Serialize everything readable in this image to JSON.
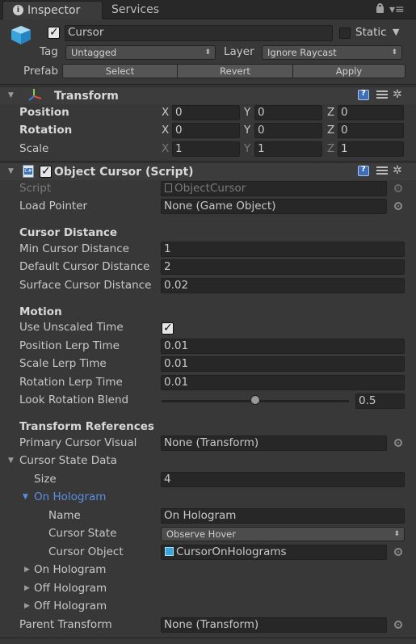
{
  "tabs": {
    "inspector": "Inspector",
    "services": "Services"
  },
  "object": {
    "name": "Cursor",
    "static_label": "Static",
    "tag_label": "Tag",
    "tag_value": "Untagged",
    "layer_label": "Layer",
    "layer_value": "Ignore Raycast",
    "prefab_label": "Prefab",
    "prefab_buttons": {
      "select": "Select",
      "revert": "Revert",
      "apply": "Apply"
    }
  },
  "transform": {
    "title": "Transform",
    "rows": [
      {
        "label": "Position",
        "x": "0",
        "y": "0",
        "z": "0"
      },
      {
        "label": "Rotation",
        "x": "0",
        "y": "0",
        "z": "0"
      },
      {
        "label": "Scale",
        "x": "1",
        "y": "1",
        "z": "1"
      }
    ],
    "axis": {
      "x": "X",
      "y": "Y",
      "z": "Z"
    }
  },
  "script": {
    "title": "Object Cursor (Script)",
    "script_label": "Script",
    "script_value": "ObjectCursor",
    "load_pointer_label": "Load Pointer",
    "load_pointer_value": "None (Game Object)",
    "cursor_distance_header": "Cursor Distance",
    "min_label": "Min Cursor Distance",
    "min_value": "1",
    "default_label": "Default Cursor Distance",
    "default_value": "2",
    "surface_label": "Surface Cursor Distance",
    "surface_value": "0.02",
    "motion_header": "Motion",
    "unscaled_label": "Use Unscaled Time",
    "unscaled_checked": true,
    "pos_lerp_label": "Position Lerp Time",
    "pos_lerp_value": "0.01",
    "scale_lerp_label": "Scale Lerp Time",
    "scale_lerp_value": "0.01",
    "rot_lerp_label": "Rotation Lerp Time",
    "rot_lerp_value": "0.01",
    "look_blend_label": "Look Rotation Blend",
    "look_blend_value": "0.5",
    "look_blend_fraction": 0.5,
    "transform_refs_header": "Transform References",
    "primary_visual_label": "Primary Cursor Visual",
    "primary_visual_value": "None (Transform)",
    "state_data_label": "Cursor State Data",
    "size_label": "Size",
    "size_value": "4",
    "element0": {
      "title": "On Hologram",
      "name_label": "Name",
      "name_value": "On Hologram",
      "state_label": "Cursor State",
      "state_value": "Observe Hover",
      "object_label": "Cursor Object",
      "object_value": "CursorOnHolograms"
    },
    "elements_collapsed": [
      "On Hologram",
      "Off Hologram",
      "Off Hologram"
    ],
    "parent_transform_label": "Parent Transform",
    "parent_transform_value": "None (Transform)"
  },
  "colors": {
    "background": "#383838",
    "field": "#272727",
    "selected_foldout": "#5a8ee0"
  }
}
